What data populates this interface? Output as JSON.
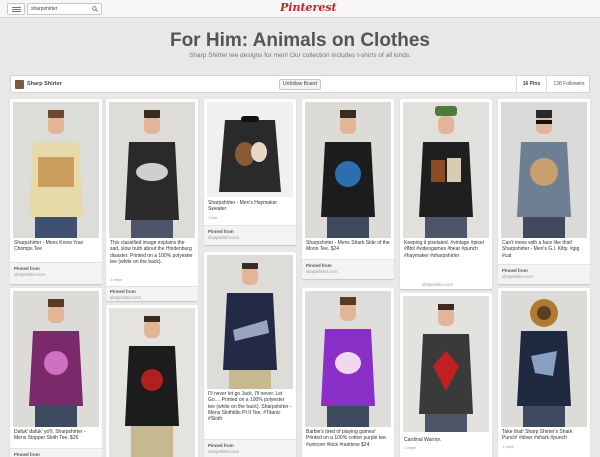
{
  "header": {
    "search_value": "sharpshirter",
    "logo": "Pinterest"
  },
  "board": {
    "title": "For Him: Animals on Clothes",
    "subtitle": "Sharp Shirter tee designs for men! Our collection includes t-shirts of all kinds.",
    "owner": "Sharp Shirter",
    "unfollow_label": "Unfollow Board",
    "pins_label": "16 Pins",
    "followers_label": "138 Followers"
  },
  "pinned_from_label": "Pinned from",
  "pins": [
    {
      "desc": "Sharpshirter - Mens Know Your Chomps Tee",
      "repin": "",
      "source": "sharpshirter.com"
    },
    {
      "desc": "This classified image explains the sad, slow truth about the Hindenburg disaster. Printed on a 100% polyester tee (white on the back).",
      "repin": "1 repin",
      "source": "sharpshirter.com"
    },
    {
      "desc": "Sharpshirter - Men's Haymaker Sweater",
      "repin": "1 like",
      "source": "sharpshirter.com"
    },
    {
      "desc": "Sharpshirter - Mens Shark Side of the Moon Tee. $24",
      "repin": "",
      "source": "sharpshirter.com"
    },
    {
      "desc": "Keeping it pixelated. #vintage #pixel #8bit #videogames #bear #punch #haymaker #sharpshirter",
      "repin": "",
      "source": "sharpshirter.com"
    },
    {
      "desc": "Can't mess with a face like that! Sharpshirter - Men's G.I. Kitty. #gig #cat",
      "repin": "",
      "source": "sharpshirter.com"
    },
    {
      "desc": "Dafuk' dafuk' yo'll. Sharpshirter - Mens Stripper Sloth Tee. $26",
      "repin": "",
      "source": "sharpshirter.com"
    },
    {
      "desc": "",
      "repin": "",
      "source": ""
    },
    {
      "desc": "I'll never let go Jack, I'll never. Let Go.... Printed on a 100% polyester tee (white on the back). Sharpshirter - Mens Slothtitle Pt II Tee. #Titanic #Sloth",
      "repin": "",
      "source": "sharpshirter.com"
    },
    {
      "desc": "Barbie's tired of playing games! Printed on a 100% cotton purple tee. #unicorn #kick #rainbow $24",
      "repin": "",
      "source": ""
    },
    {
      "desc": "Cardinal Warrior.",
      "repin": "1 repin",
      "source": ""
    },
    {
      "desc": "Take that! Sharp Shirter's Shark Punch! #diver #shark #punch",
      "repin": "1 repin",
      "source": ""
    }
  ],
  "colors": {
    "background": "#e9e7e7",
    "brand_red": "#c8232c"
  }
}
